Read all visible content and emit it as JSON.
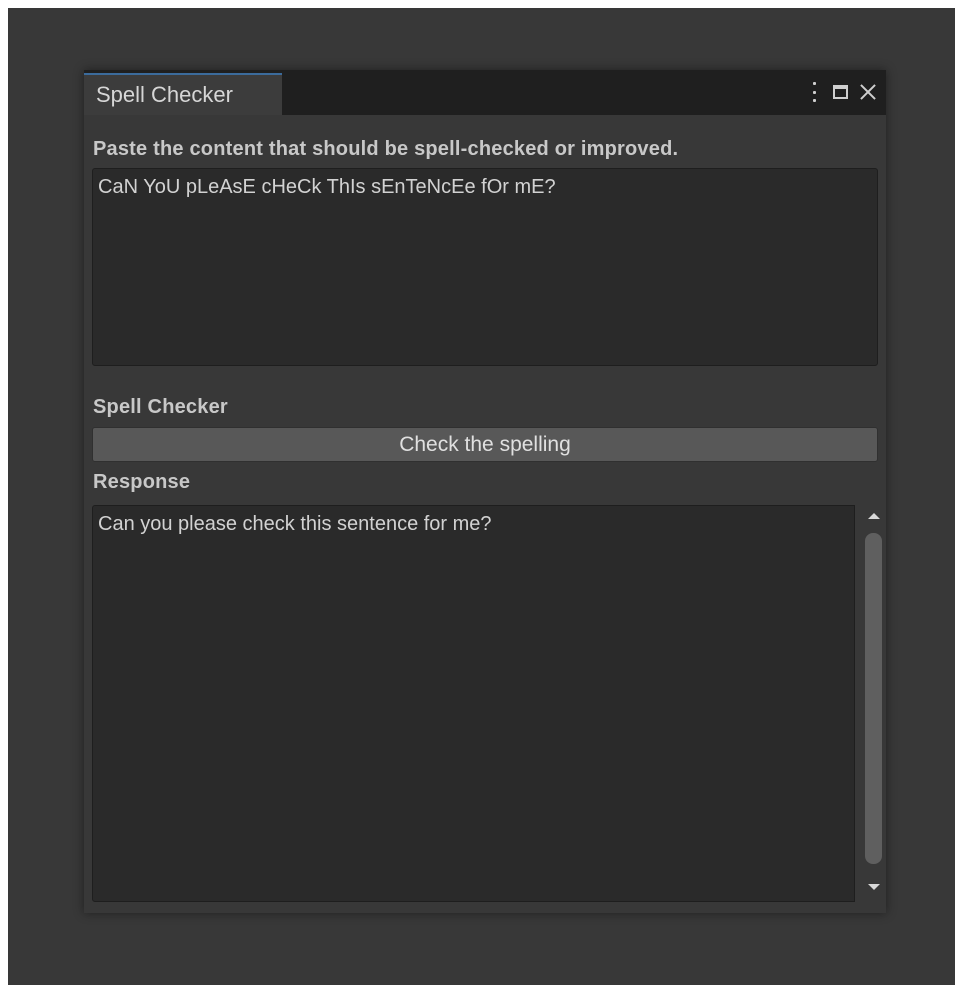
{
  "window": {
    "tab_title": "Spell Checker"
  },
  "prompt": {
    "label": "Paste the content that should be spell-checked or improved.",
    "value": "CaN YoU pLeAsE cHeCk ThIs sEnTeNcEe fOr mE?"
  },
  "spell_checker": {
    "label": "Spell Checker",
    "button_label": "Check the spelling"
  },
  "response": {
    "label": "Response",
    "value": "Can you please check this sentence for me?"
  },
  "icons": {
    "menu": "kebab-menu-icon",
    "maximize": "maximize-icon",
    "close": "close-icon",
    "scroll_up": "scroll-up-arrow-icon",
    "scroll_down": "scroll-down-arrow-icon"
  },
  "colors": {
    "tab_accent": "#3b6b9c",
    "background": "#383838",
    "field_background": "#2a2a2a",
    "button_background": "#585858"
  }
}
